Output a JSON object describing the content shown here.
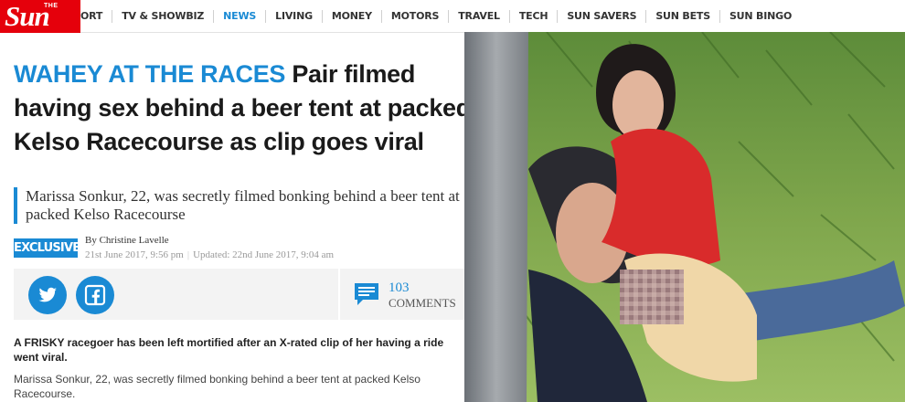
{
  "nav": {
    "logo_word": "Sun",
    "logo_small": "THE",
    "items": [
      {
        "label": "ORT"
      },
      {
        "label": "TV & SHOWBIZ"
      },
      {
        "label": "NEWS",
        "active": true
      },
      {
        "label": "LIVING"
      },
      {
        "label": "MONEY"
      },
      {
        "label": "MOTORS"
      },
      {
        "label": "TRAVEL"
      },
      {
        "label": "TECH"
      },
      {
        "label": "SUN SAVERS"
      },
      {
        "label": "SUN BETS"
      },
      {
        "label": "SUN BINGO"
      }
    ]
  },
  "article": {
    "kicker": "WAHEY AT THE RACES",
    "headline": "Pair filmed having sex behind a beer tent at packed Kelso Racecourse as clip goes viral",
    "standfirst": "Marissa Sonkur, 22, was secretly filmed bonking behind a beer tent  at packed Kelso Racecourse",
    "badge": "EXCLUSIVE",
    "byline": "By Christine Lavelle",
    "published": "21st June 2017, 9:56 pm",
    "updated": "Updated: 22nd June 2017, 9:04 am",
    "comments_count": "103",
    "comments_label": "COMMENTS",
    "lead": "A FRISKY racegoer has been left mortified after an X-rated clip of her having a ride went viral.",
    "paragraph": "Marissa Sonkur, 22, was secretly filmed bonking behind a beer tent  at packed Kelso Racecourse."
  },
  "icons": {
    "twitter": "twitter-icon",
    "facebook": "facebook-icon",
    "comments": "comments-icon"
  },
  "colors": {
    "brand_red": "#e5000b",
    "accent_blue": "#1a8ad4",
    "share_bg": "#f3f3f3"
  }
}
